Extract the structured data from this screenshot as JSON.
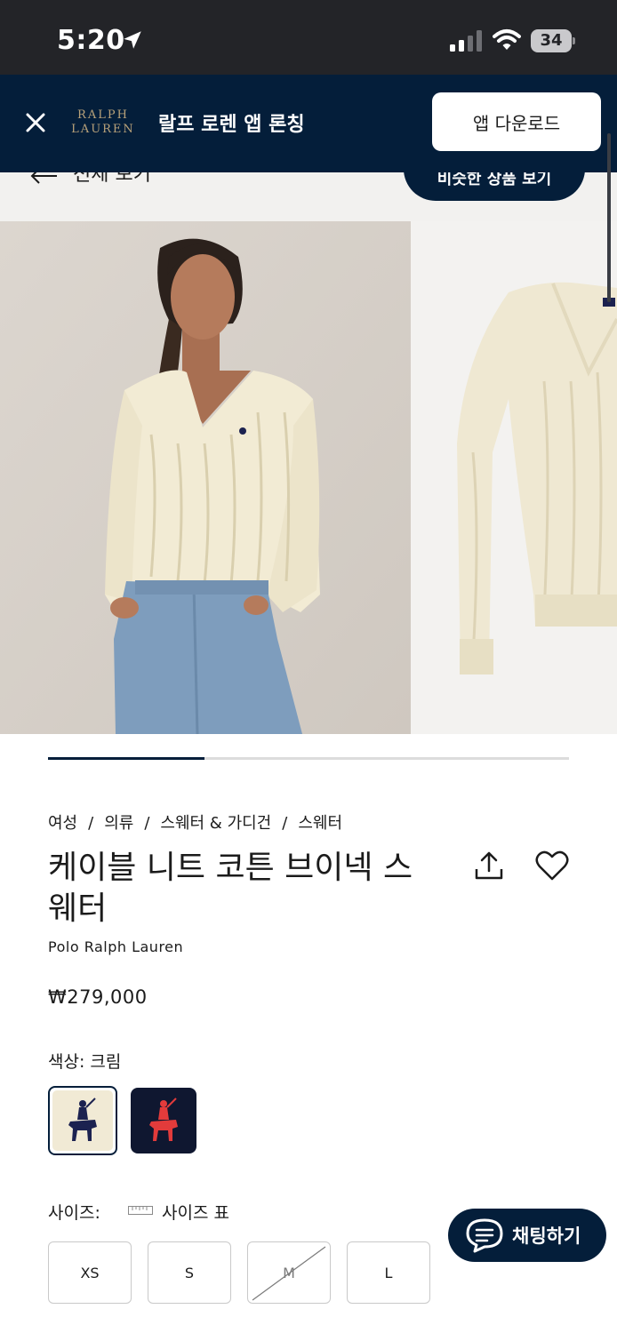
{
  "status_bar": {
    "time": "5:20",
    "battery": "34"
  },
  "app_banner": {
    "logo_line1": "RALPH",
    "logo_line2": "LAUREN",
    "title": "랄프 로렌 앱 론칭",
    "download_label": "앱 다운로드"
  },
  "nav": {
    "back_label": "전체 보기",
    "similar_label": "비슷한 상품 보기"
  },
  "gallery": {
    "image_count": 2,
    "progress": 0.3
  },
  "breadcrumb": [
    "여성",
    "의류",
    "스웨터 & 가디건",
    "스웨터"
  ],
  "product": {
    "title": "케이블 니트 코튼 브이넥 스웨터",
    "brand": "Polo Ralph Lauren",
    "price": "₩279,000"
  },
  "color": {
    "label": "색상: 크림",
    "swatches": [
      {
        "name": "크림",
        "bg": "#f1ead5",
        "logo": "#1c2250",
        "selected": true
      },
      {
        "name": "네이비",
        "bg": "#0f1730",
        "logo": "#e23b3b",
        "selected": false
      }
    ]
  },
  "size": {
    "label": "사이즈:",
    "chart_label": "사이즈 표",
    "options": [
      {
        "label": "XS",
        "available": true
      },
      {
        "label": "S",
        "available": true
      },
      {
        "label": "M",
        "available": false
      },
      {
        "label": "L",
        "available": true
      }
    ]
  },
  "chat": {
    "label": "채팅하기"
  },
  "colors": {
    "navy": "#041e3a",
    "gold": "#b9a27a",
    "status_bg": "#232428"
  }
}
